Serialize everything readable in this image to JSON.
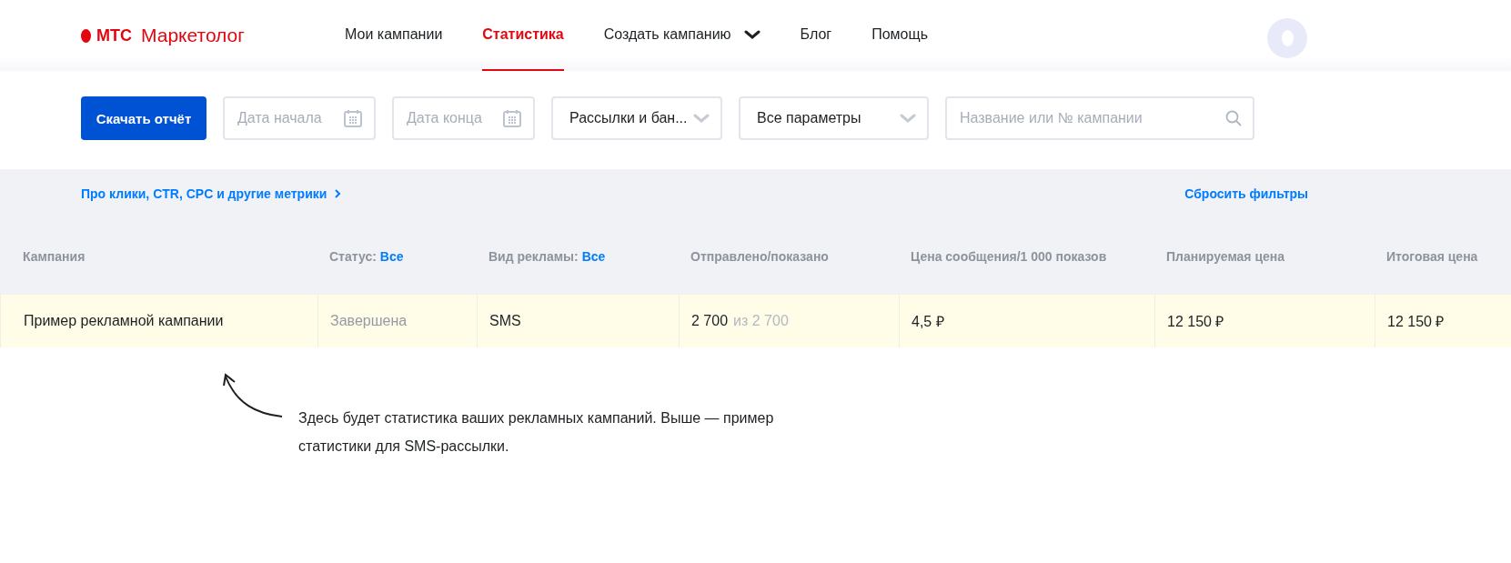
{
  "header": {
    "logo": {
      "brand": "МТС",
      "product": "Маркетолог"
    },
    "nav": [
      {
        "label": "Мои кампании",
        "selected": false,
        "kind": "link"
      },
      {
        "label": "Статистика",
        "selected": true,
        "kind": "link"
      },
      {
        "label": "Создать кампанию",
        "selected": false,
        "kind": "dropdown"
      },
      {
        "label": "Блог",
        "selected": false,
        "kind": "link"
      },
      {
        "label": "Помощь",
        "selected": false,
        "kind": "link"
      }
    ]
  },
  "filters": {
    "button": "Скачать отчёт",
    "fields": [
      {
        "kind": "date",
        "placeholder": "Дата начала"
      },
      {
        "kind": "date",
        "placeholder": "Дата конца"
      },
      {
        "kind": "select",
        "value": "Рассылки и бан..."
      },
      {
        "kind": "select",
        "value": "Все параметры"
      },
      {
        "kind": "search",
        "placeholder": "Название или № кампании"
      }
    ]
  },
  "info_link": "Про клики, CTR, CPC и другие метрики",
  "reset_link": "Сбросить фильтры",
  "table": {
    "columns": [
      {
        "label": "Кампания"
      },
      {
        "label": "Статус:",
        "filter": "Все"
      },
      {
        "label": "Вид рекламы:",
        "filter": "Все"
      },
      {
        "label": "Отправлено/показано"
      },
      {
        "label": "Цена сообщения/1 000 показов"
      },
      {
        "label": "Планируемая цена"
      },
      {
        "label": "Итоговая цена"
      }
    ],
    "rows": [
      {
        "cells": [
          {
            "text": "Пример рекламной кампании",
            "muted": false
          },
          {
            "text": "Завершена",
            "muted": true
          },
          {
            "text": "SMS",
            "muted": false
          },
          {
            "text": "2 700",
            "muted": false,
            "total": "из 2 700"
          },
          {
            "text": "4,5 ₽",
            "muted": false
          },
          {
            "text": "12 150 ₽",
            "muted": false
          },
          {
            "text": "12 150 ₽",
            "muted": false
          }
        ]
      }
    ]
  },
  "note": "Здесь будет статистика ваших рекламных кампаний. Выше — пример статистики для SMS-рассылки."
}
